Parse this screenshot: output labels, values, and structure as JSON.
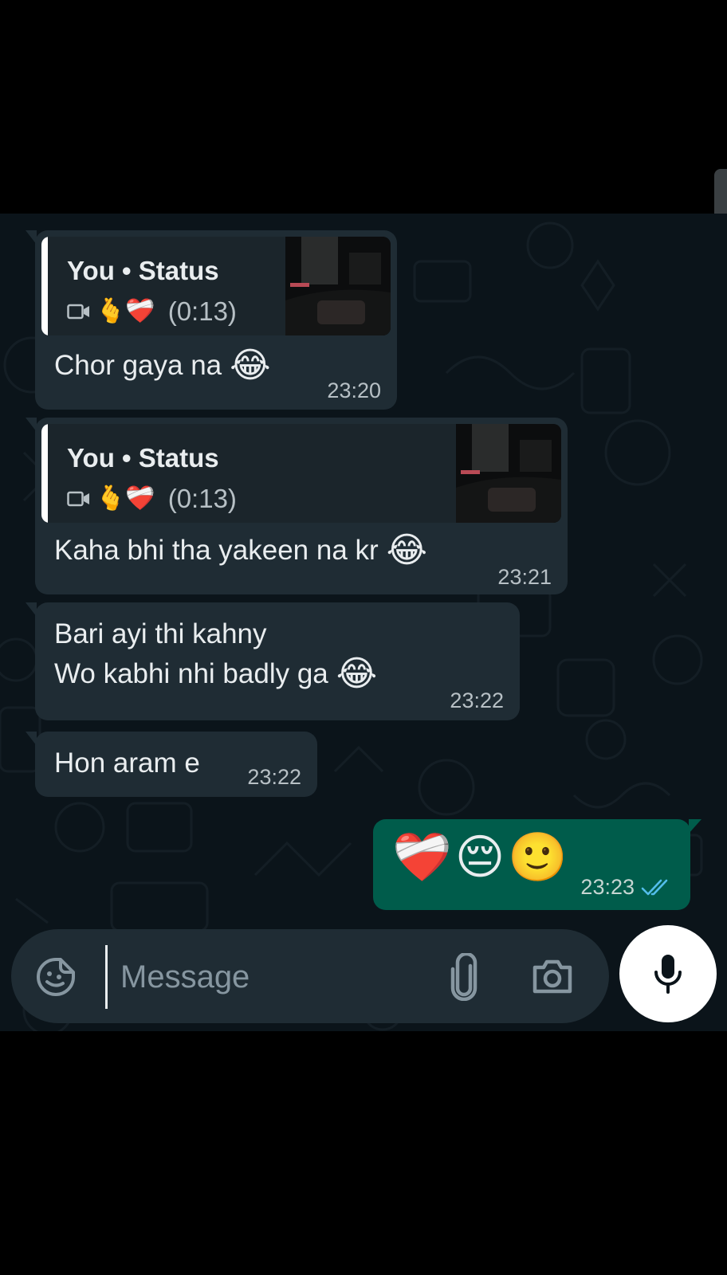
{
  "chat": {
    "messages": [
      {
        "direction": "in",
        "quote": {
          "title": "You • Status",
          "emojis": "🫰❤️‍🩹",
          "duration": "(0:13)",
          "media": "video-icon"
        },
        "text": "Chor gaya na",
        "emoji": "😂",
        "time": "23:20"
      },
      {
        "direction": "in",
        "quote": {
          "title": "You • Status",
          "emojis": "🫰❤️‍🩹",
          "duration": "(0:13)",
          "media": "video-icon"
        },
        "text": "Kaha bhi tha yakeen na kr",
        "emoji": "😂",
        "time": "23:21"
      },
      {
        "direction": "in",
        "lines": [
          "Bari ayi thi kahny",
          "Wo kabhi nhi badly ga"
        ],
        "emoji": "😂",
        "time": "23:22"
      },
      {
        "direction": "in",
        "text": "Hon aram e",
        "time": "23:22"
      },
      {
        "direction": "out",
        "emojis": [
          "❤️‍🩹",
          "😔",
          "🙂"
        ],
        "time": "23:23",
        "status": "read"
      }
    ]
  },
  "composer": {
    "placeholder": "Message",
    "icons": [
      "sticker-icon",
      "attach-icon",
      "camera-icon",
      "mic-icon"
    ]
  },
  "colors": {
    "background": "#0b141a",
    "incoming_bubble": "#1f2c34",
    "outgoing_bubble": "#005c4b",
    "read_ticks": "#53bdeb"
  }
}
